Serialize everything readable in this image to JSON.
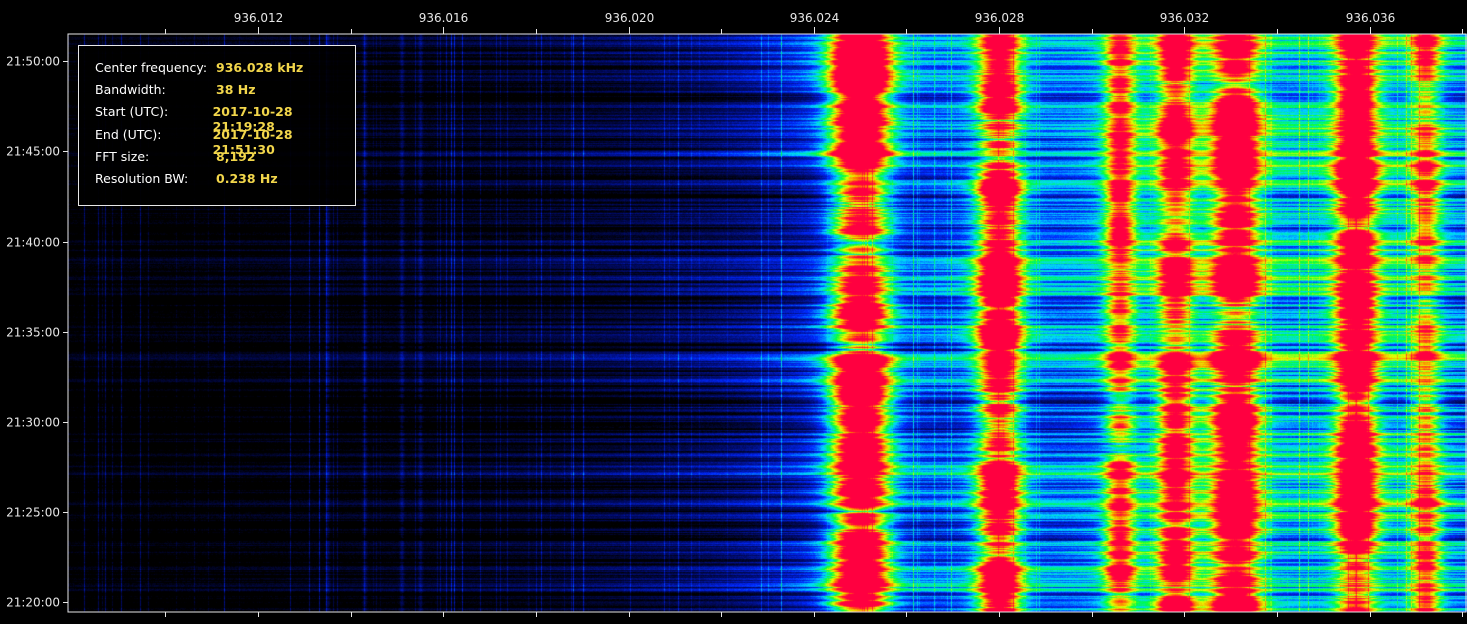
{
  "colors": {
    "background": "#000000",
    "axis": "#e6e6e6",
    "value": "#f2d64b"
  },
  "info_panel": {
    "rows": [
      {
        "label": "Center frequency:",
        "value": "936.028 kHz"
      },
      {
        "label": "Bandwidth:",
        "value": "38 Hz"
      },
      {
        "label": "Start (UTC):",
        "value": "2017-10-28 21:19:28"
      },
      {
        "label": "End (UTC):",
        "value": "2017-10-28 21:51:30"
      },
      {
        "label": "FFT size:",
        "value": "8,192"
      },
      {
        "label": "Resolution BW:",
        "value": "0.238 Hz"
      }
    ]
  },
  "chart_data": {
    "type": "heatmap",
    "title": "",
    "xlabel": "",
    "ylabel": "",
    "x_ticks": [
      "936.012",
      "936.016",
      "936.020",
      "936.024",
      "936.028",
      "936.032",
      "936.036"
    ],
    "x_tick_values_khz": [
      936.012,
      936.016,
      936.02,
      936.024,
      936.028,
      936.032,
      936.036
    ],
    "xlim_khz": [
      936.0079,
      936.0381
    ],
    "y_ticks": [
      "21:50:00",
      "21:45:00",
      "21:40:00",
      "21:35:00",
      "21:30:00",
      "21:25:00",
      "21:20:00"
    ],
    "y_tick_minutes": [
      1250,
      1245,
      1240,
      1235,
      1230,
      1225,
      1220
    ],
    "ylim_minutes": [
      1219.467,
      1251.5
    ],
    "colormap": [
      "#000000",
      "#000b6e",
      "#0028ff",
      "#00d8ff",
      "#00ff3c",
      "#e6ff00",
      "#ff8000",
      "#ff0040"
    ],
    "carriers": [
      {
        "freq_khz": 936.025,
        "level": 1.0,
        "width_hz": 0.55
      },
      {
        "freq_khz": 936.028,
        "level": 0.86,
        "width_hz": 0.42
      },
      {
        "freq_khz": 936.0331,
        "level": 0.84,
        "width_hz": 0.45
      },
      {
        "freq_khz": 936.0357,
        "level": 0.74,
        "width_hz": 0.4
      },
      {
        "freq_khz": 936.0318,
        "level": 0.64,
        "width_hz": 0.35
      },
      {
        "freq_khz": 936.0306,
        "level": 0.55,
        "width_hz": 0.3
      },
      {
        "freq_khz": 936.0372,
        "level": 0.45,
        "width_hz": 0.3
      }
    ]
  }
}
